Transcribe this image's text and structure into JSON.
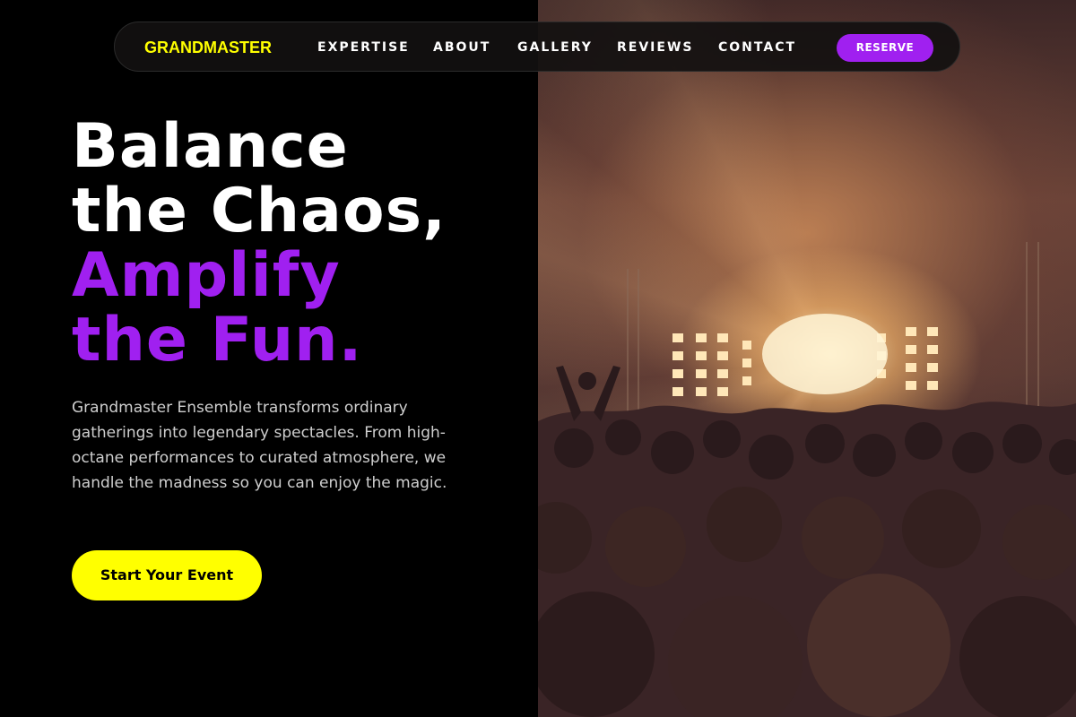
{
  "nav": {
    "logo": "GRANDMASTER",
    "links": [
      "EXPERTISE",
      "ABOUT",
      "GALLERY",
      "REVIEWS",
      "CONTACT"
    ],
    "reserve_label": "RESERVE"
  },
  "hero": {
    "headline_white": [
      "Balance",
      "the Chaos,"
    ],
    "headline_purple": [
      "Amplify",
      "the Fun."
    ],
    "description": "Grandmaster Ensemble transforms ordinary gatherings into legendary spectacles. From high-octane performances to curated atmosphere, we handle the madness so you can enjoy the magic.",
    "cta_label": "Start Your Event",
    "image": "concert-crowd-stage-lights-photo"
  },
  "colors": {
    "accent_yellow": "#ffff00",
    "accent_purple": "#a020f0",
    "background": "#000000"
  }
}
